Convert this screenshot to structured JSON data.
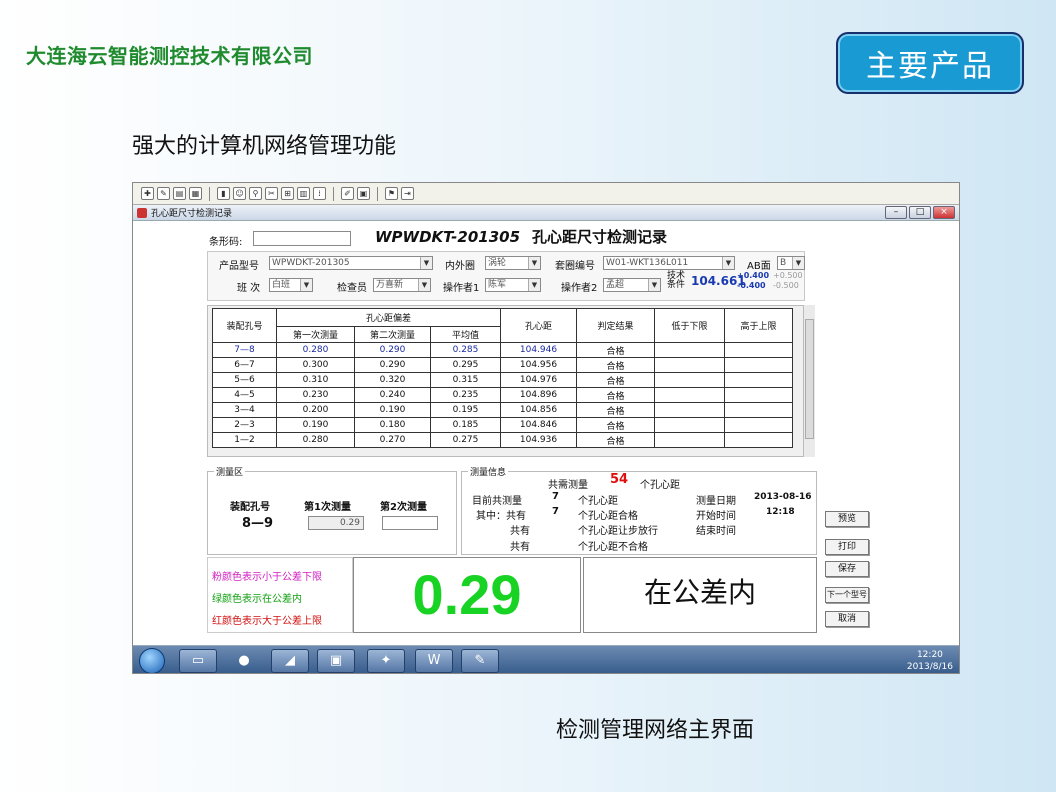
{
  "slide": {
    "company": "大连海云智能测控技术有限公司",
    "badge": "主要产品",
    "headline": "强大的计算机网络管理功能",
    "caption": "检测管理网络主界面"
  },
  "window": {
    "title": "孔心距尺寸检测记录",
    "buttons": {
      "minimize": "–",
      "maximize": "□",
      "close": "×"
    }
  },
  "form": {
    "barcode_label": "条形码:",
    "barcode_value": "",
    "heading_model": "WPWDKT-201305",
    "heading_text": "孔心距尺寸检测记录",
    "product_label": "产品型号",
    "product_value": "WPWDKT-201305",
    "ring_label": "内外圈",
    "ring_value": "涡轮",
    "set_label": "套圈编号",
    "set_value": "W01-WKT136L011",
    "ab_label": "AB面",
    "ab_value": "B",
    "shift_label": "班  次",
    "shift_value": "白班",
    "inspector_label": "检查员",
    "inspector_value": "万喜新",
    "operator1_label": "操作者1",
    "operator1_value": "陈军",
    "operator2_label": "操作者2",
    "operator2_value": "孟超",
    "tech_label_1": "技术",
    "tech_label_2": "条件",
    "tech_value": "104.661",
    "tol_plus": "+0.400",
    "tol_minus": "-0.400",
    "tol_plus2": "+0.500",
    "tol_minus2": "-0.500"
  },
  "table": {
    "headers": {
      "hole": "装配孔号",
      "dev": "孔心距偏差",
      "first": "第一次测量",
      "second": "第二次测量",
      "avg": "平均值",
      "dist": "孔心距",
      "result": "判定结果",
      "below": "低于下限",
      "above": "高于上限"
    },
    "rows": [
      {
        "hole": "7—8",
        "first": "0.280",
        "second": "0.290",
        "avg": "0.285",
        "dist": "104.946",
        "result": "合格"
      },
      {
        "hole": "6—7",
        "first": "0.300",
        "second": "0.290",
        "avg": "0.295",
        "dist": "104.956",
        "result": "合格"
      },
      {
        "hole": "5—6",
        "first": "0.310",
        "second": "0.320",
        "avg": "0.315",
        "dist": "104.976",
        "result": "合格"
      },
      {
        "hole": "4—5",
        "first": "0.230",
        "second": "0.240",
        "avg": "0.235",
        "dist": "104.896",
        "result": "合格"
      },
      {
        "hole": "3—4",
        "first": "0.200",
        "second": "0.190",
        "avg": "0.195",
        "dist": "104.856",
        "result": "合格"
      },
      {
        "hole": "2—3",
        "first": "0.190",
        "second": "0.180",
        "avg": "0.185",
        "dist": "104.846",
        "result": "合格"
      },
      {
        "hole": "1—2",
        "first": "0.280",
        "second": "0.270",
        "avg": "0.275",
        "dist": "104.936",
        "result": "合格"
      }
    ]
  },
  "measure": {
    "group_label": "测量区",
    "hole_label": "装配孔号",
    "hole_value": "8—9",
    "first_label": "第1次测量",
    "first_value": "0.29",
    "second_label": "第2次测量",
    "second_value": ""
  },
  "info": {
    "group_label": "测量信息",
    "total_prefix": "共需测量",
    "total_count": "54",
    "total_suffix": "个孔心距",
    "done_label": "目前共测量",
    "done_count": "7",
    "done_suffix": "个孔心距",
    "ok_label": "其中：共有",
    "ok_count": "7",
    "ok_suffix": "个孔心距合格",
    "concession_label": "共有",
    "concession_suffix": "个孔心距让步放行",
    "fail_label": "共有",
    "fail_suffix": "个孔心距不合格",
    "date_label": "测量日期",
    "date_value": "2013-08-16",
    "start_label": "开始时间",
    "start_value": "12:18",
    "end_label": "结束时间",
    "end_value": ""
  },
  "legend": {
    "pink": "粉颜色表示小于公差下限",
    "green": "绿颜色表示在公差内",
    "red": "红颜色表示大于公差上限"
  },
  "display": {
    "value": "0.29",
    "verdict": "在公差内"
  },
  "buttons": {
    "preview": "预览",
    "print": "打印",
    "save": "保存",
    "next_model": "下一个型号",
    "cancel": "取消"
  },
  "taskbar": {
    "time": "12:20",
    "date": "2013/8/16"
  },
  "colors": {
    "company_green": "#1f8b2e",
    "badge_blue": "#1a9ad2",
    "value_green": "#18d323",
    "count_red": "#e01010",
    "legend_pink": "#d020c0",
    "legend_green": "#10a010",
    "legend_red": "#d01010",
    "table_blue": "#1a2aa0"
  }
}
